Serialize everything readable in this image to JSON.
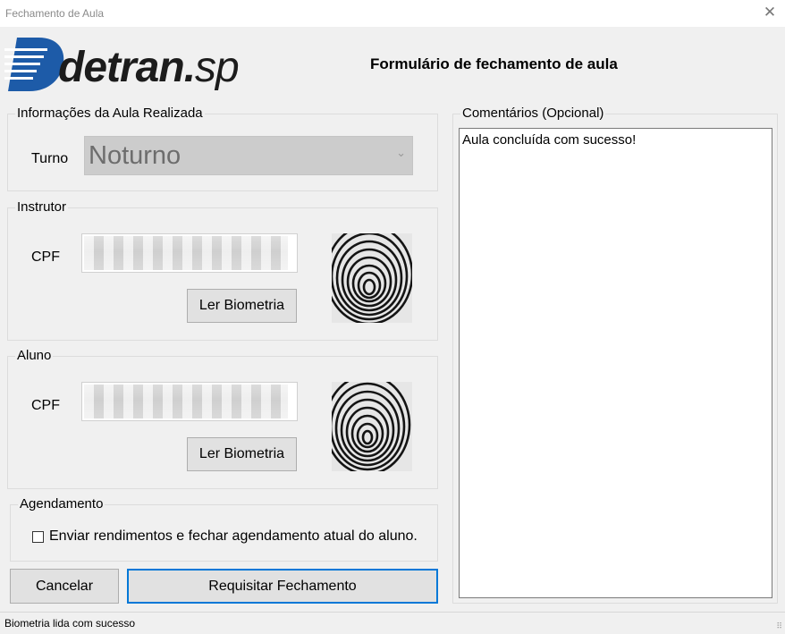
{
  "window": {
    "title": "Fechamento de Aula",
    "close_glyph": "✕"
  },
  "logo": {
    "brand_bold": "detran",
    "brand_dot": ".",
    "brand_light": "sp",
    "accent": "#1d5ba8"
  },
  "header": {
    "form_title": "Formulário de fechamento de aula"
  },
  "aula": {
    "group_title": "Informações da Aula Realizada",
    "turno_label": "Turno",
    "turno_value": "Noturno"
  },
  "instrutor": {
    "group_title": "Instrutor",
    "cpf_label": "CPF",
    "biometria_button": "Ler Biometria",
    "fingerprint_icon": "fingerprint-icon"
  },
  "aluno": {
    "group_title": "Aluno",
    "cpf_label": "CPF",
    "biometria_button": "Ler Biometria",
    "fingerprint_icon": "fingerprint-icon"
  },
  "agendamento": {
    "group_title": "Agendamento",
    "checkbox_label": "Enviar rendimentos e fechar agendamento atual do aluno.",
    "checked": false
  },
  "actions": {
    "cancel": "Cancelar",
    "submit": "Requisitar Fechamento"
  },
  "comentarios": {
    "group_title": "Comentários (Opcional)",
    "value": "Aula concluída com sucesso!"
  },
  "status": {
    "text": "Biometria lida com sucesso",
    "grip": "⠿"
  },
  "colors": {
    "primary_border": "#0078d7",
    "disabled_combo": "#cccccc"
  }
}
